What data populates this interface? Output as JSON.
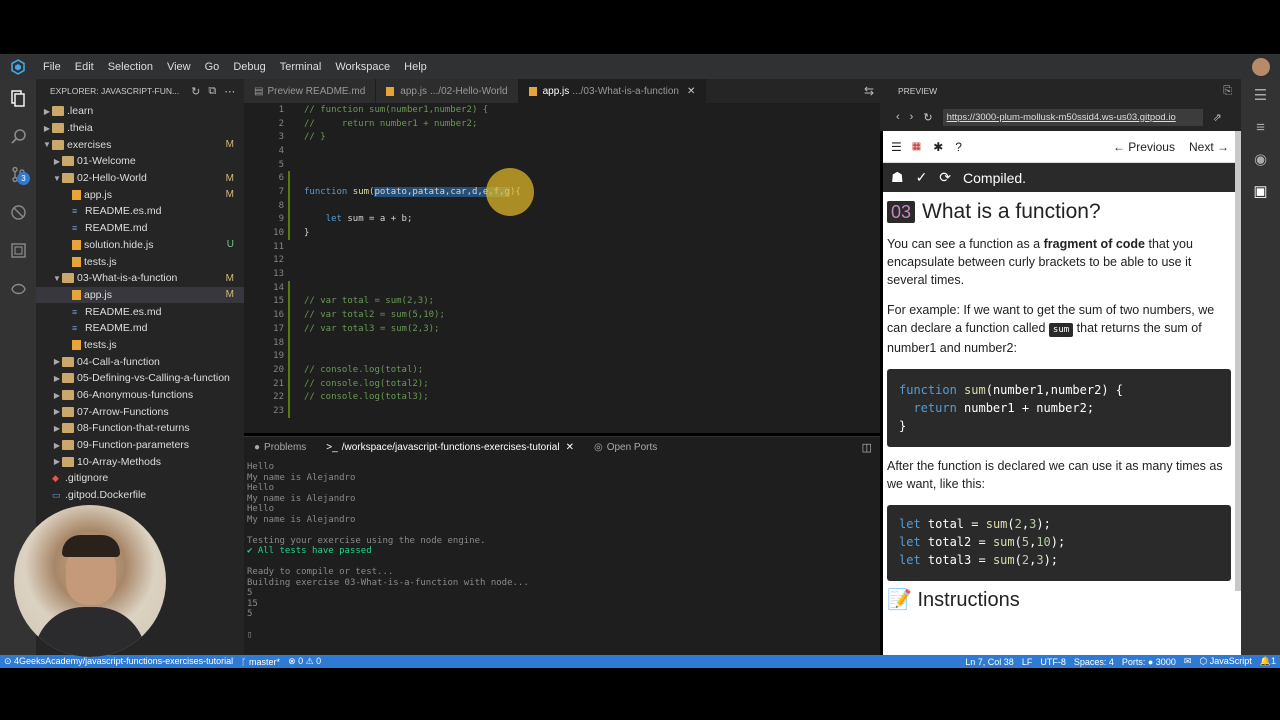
{
  "menubar": {
    "items": [
      "File",
      "Edit",
      "Selection",
      "View",
      "Go",
      "Debug",
      "Terminal",
      "Workspace",
      "Help"
    ]
  },
  "activity": {
    "scm_badge": "3"
  },
  "explorer": {
    "title": "EXPLORER: JAVASCRIPT-FUN...",
    "items": [
      {
        "label": ".learn",
        "type": "folder",
        "depth": 0,
        "expanded": false,
        "status": ""
      },
      {
        "label": ".theia",
        "type": "folder",
        "depth": 0,
        "expanded": false,
        "status": ""
      },
      {
        "label": "exercises",
        "type": "folder",
        "depth": 0,
        "expanded": true,
        "status": "M"
      },
      {
        "label": "01-Welcome",
        "type": "folder",
        "depth": 1,
        "expanded": false,
        "status": ""
      },
      {
        "label": "02-Hello-World",
        "type": "folder",
        "depth": 1,
        "expanded": true,
        "status": "M"
      },
      {
        "label": "app.js",
        "type": "js",
        "depth": 2,
        "status": "M"
      },
      {
        "label": "README.es.md",
        "type": "md",
        "depth": 2,
        "status": ""
      },
      {
        "label": "README.md",
        "type": "md",
        "depth": 2,
        "status": ""
      },
      {
        "label": "solution.hide.js",
        "type": "js",
        "depth": 2,
        "status": "U"
      },
      {
        "label": "tests.js",
        "type": "js",
        "depth": 2,
        "status": ""
      },
      {
        "label": "03-What-is-a-function",
        "type": "folder",
        "depth": 1,
        "expanded": true,
        "status": "M"
      },
      {
        "label": "app.js",
        "type": "js",
        "depth": 2,
        "status": "M",
        "selected": true
      },
      {
        "label": "README.es.md",
        "type": "md",
        "depth": 2,
        "status": ""
      },
      {
        "label": "README.md",
        "type": "md",
        "depth": 2,
        "status": ""
      },
      {
        "label": "tests.js",
        "type": "js",
        "depth": 2,
        "status": ""
      },
      {
        "label": "04-Call-a-function",
        "type": "folder",
        "depth": 1,
        "expanded": false,
        "status": ""
      },
      {
        "label": "05-Defining-vs-Calling-a-function",
        "type": "folder",
        "depth": 1,
        "expanded": false,
        "status": ""
      },
      {
        "label": "06-Anonymous-functions",
        "type": "folder",
        "depth": 1,
        "expanded": false,
        "status": ""
      },
      {
        "label": "07-Arrow-Functions",
        "type": "folder",
        "depth": 1,
        "expanded": false,
        "status": ""
      },
      {
        "label": "08-Function-that-returns",
        "type": "folder",
        "depth": 1,
        "expanded": false,
        "status": ""
      },
      {
        "label": "09-Function-parameters",
        "type": "folder",
        "depth": 1,
        "expanded": false,
        "status": ""
      },
      {
        "label": "10-Array-Methods",
        "type": "folder",
        "depth": 1,
        "expanded": false,
        "status": ""
      },
      {
        "label": ".gitignore",
        "type": "git",
        "depth": 0,
        "status": ""
      },
      {
        "label": ".gitpod.Dockerfile",
        "type": "docker",
        "depth": 0,
        "status": ""
      }
    ]
  },
  "tabs": [
    {
      "label": "Preview README.md",
      "path": "",
      "active": false,
      "icon": "preview-icon"
    },
    {
      "label": "app.js",
      "path": ".../02-Hello-World",
      "active": false,
      "icon": "js-icon"
    },
    {
      "label": "app.js",
      "path": ".../03-What-is-a-function",
      "active": true,
      "icon": "js-icon"
    }
  ],
  "editor": {
    "lines": [
      {
        "n": "1",
        "html": "<span class='cm'>// function sum(number1,number2) {</span>"
      },
      {
        "n": "2",
        "html": "<span class='cm'>//     return number1 + number2;</span>"
      },
      {
        "n": "3",
        "html": "<span class='cm'>// }</span>"
      },
      {
        "n": "4",
        "html": ""
      },
      {
        "n": "5",
        "html": ""
      },
      {
        "n": "6",
        "html": ""
      },
      {
        "n": "7",
        "html": "<span class='kw'>function</span> <span class='fn'>sum</span>(<span class='sel-hl'>potato,patata,car,d,e,f,g</span>){"
      },
      {
        "n": "8",
        "html": ""
      },
      {
        "n": "9",
        "html": "    <span class='kw'>let</span> sum = a + b;"
      },
      {
        "n": "10",
        "html": "}"
      },
      {
        "n": "11",
        "html": ""
      },
      {
        "n": "12",
        "html": ""
      },
      {
        "n": "13",
        "html": ""
      },
      {
        "n": "14",
        "html": ""
      },
      {
        "n": "15",
        "html": "<span class='cm'>// var total = sum(2,3);</span>"
      },
      {
        "n": "16",
        "html": "<span class='cm'>// var total2 = sum(5,10);</span>"
      },
      {
        "n": "17",
        "html": "<span class='cm'>// var total3 = sum(2,3);</span>"
      },
      {
        "n": "18",
        "html": ""
      },
      {
        "n": "19",
        "html": ""
      },
      {
        "n": "20",
        "html": "<span class='cm'>// console.log(total);</span>"
      },
      {
        "n": "21",
        "html": "<span class='cm'>// console.log(total2);</span>"
      },
      {
        "n": "22",
        "html": "<span class='cm'>// console.log(total3);</span>"
      },
      {
        "n": "23",
        "html": ""
      }
    ]
  },
  "panel": {
    "tabs": [
      "Problems",
      "/workspace/javascript-functions-exercises-tutorial",
      "Open Ports"
    ],
    "terminal_lines": [
      {
        "text": "Hello",
        "style": ""
      },
      {
        "text": "My name is Alejandro",
        "style": ""
      },
      {
        "text": "Hello",
        "style": ""
      },
      {
        "text": "My name is Alejandro",
        "style": ""
      },
      {
        "text": "Hello",
        "style": ""
      },
      {
        "text": "My name is Alejandro",
        "style": ""
      },
      {
        "text": "",
        "style": ""
      },
      {
        "text": "Testing your exercise using the node engine.",
        "style": ""
      },
      {
        "text": "✔ All tests have passed",
        "style": "green"
      },
      {
        "text": "",
        "style": ""
      },
      {
        "text": "Ready to compile or test...",
        "style": ""
      },
      {
        "text": "Building exercise 03-What-is-a-function with node...",
        "style": ""
      },
      {
        "text": "5",
        "style": ""
      },
      {
        "text": "15",
        "style": ""
      },
      {
        "text": "5",
        "style": ""
      },
      {
        "text": "",
        "style": ""
      },
      {
        "text": "▯",
        "style": ""
      }
    ]
  },
  "preview": {
    "header": "PREVIEW",
    "url": "https://3000-plum-mollusk-m50ssid4.ws-us03.gitpod.io",
    "prev_label": "← Previous",
    "next_label": "Next →",
    "status": "Compiled.",
    "title_num": "03",
    "title": "What is a function?",
    "p1_a": "You can see a function as a ",
    "p1_b": "fragment of code",
    "p1_c": " that you encapsulate between curly brackets to be able to use it several times.",
    "p2_a": "For example: If we want to get the sum of two numbers, we can declare a function called ",
    "p2_code": "sum",
    "p2_b": " that returns the sum of number1 and number2:",
    "code1": "<span class='cb-kw'>function</span> <span class='cb-fn'>sum</span>(number1,number2) {\n  <span class='cb-kw'>return</span> number1 + number2;\n}",
    "p3": "After the function is declared we can use it as many times as we want, like this:",
    "code2": "<span class='cb-kw'>let</span> total = <span class='cb-fn'>sum</span>(<span class='cb-num'>2</span>,<span class='cb-num'>3</span>);\n<span class='cb-kw'>let</span> total2 = <span class='cb-fn'>sum</span>(<span class='cb-num'>5</span>,<span class='cb-num'>10</span>);\n<span class='cb-kw'>let</span> total3 = <span class='cb-fn'>sum</span>(<span class='cb-num'>2</span>,<span class='cb-num'>3</span>);",
    "instructions": "📝 Instructions"
  },
  "statusbar": {
    "repo": "4GeeksAcademy/javascript-functions-exercises-tutorial",
    "branch": "master*",
    "problems": "⊗ 0 ⚠ 0",
    "position": "Ln 7, Col 38",
    "eol": "LF",
    "encoding": "UTF-8",
    "spaces": "Spaces: 4",
    "ports": "Ports: ● 3000",
    "language": "JavaScript",
    "notifications": "1"
  },
  "colors": {
    "accent": "#2f7bd4",
    "selection": "#264f78"
  }
}
